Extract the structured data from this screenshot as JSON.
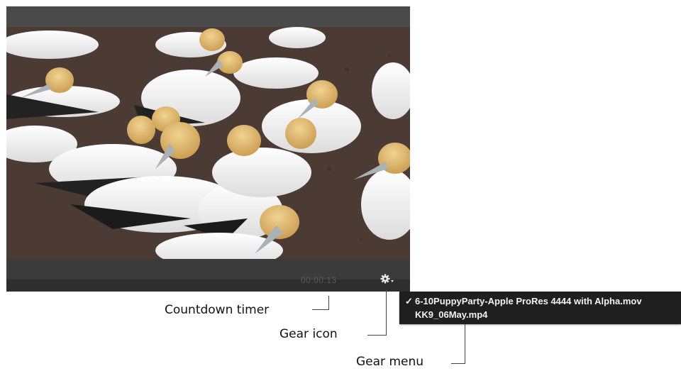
{
  "player": {
    "timer": "00:00:13",
    "gear_icon": "gear-icon"
  },
  "gear_menu": {
    "items": [
      {
        "label": "6-10PuppyParty-Apple ProRes 4444 with Alpha.mov",
        "checked": true
      },
      {
        "label": "KK9_06May.mp4",
        "checked": false
      }
    ],
    "check_mark": "✓"
  },
  "annotations": {
    "countdown_timer": "Countdown timer",
    "gear_icon": "Gear icon",
    "gear_menu": "Gear menu"
  }
}
